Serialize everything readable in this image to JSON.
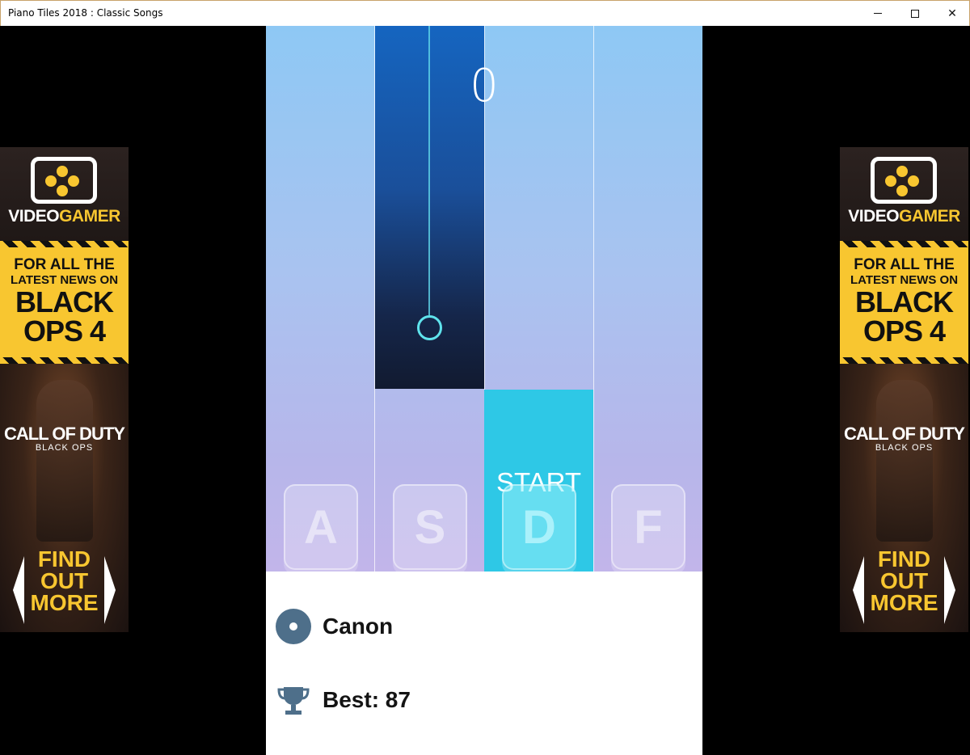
{
  "window": {
    "title": "Piano Tiles 2018 : Classic Songs",
    "minimize_label": "",
    "maximize_label": "",
    "close_label": "✕"
  },
  "ad": {
    "brand_part1": "VIDEO",
    "brand_part2": "GAMER",
    "headline_line1": "FOR ALL THE",
    "headline_line2": "LATEST NEWS ON",
    "headline_line3": "BLACK",
    "headline_line4": "OPS 4",
    "game_title": "CALL OF DUTY",
    "game_subtitle": "BLACK OPS",
    "cta_line1": "FIND",
    "cta_line2": "OUT",
    "cta_line3": "MORE"
  },
  "game": {
    "score": "0",
    "start_label": "START",
    "keys": [
      "A",
      "S",
      "D",
      "F"
    ],
    "colors": {
      "black_tile": "#1565c0",
      "start_tile": "#2ec8e6",
      "ring": "#5fe3ec"
    }
  },
  "info": {
    "song_icon": "disc-icon",
    "song_name": "Canon",
    "best_icon": "trophy-icon",
    "best_label": "Best: 87"
  }
}
